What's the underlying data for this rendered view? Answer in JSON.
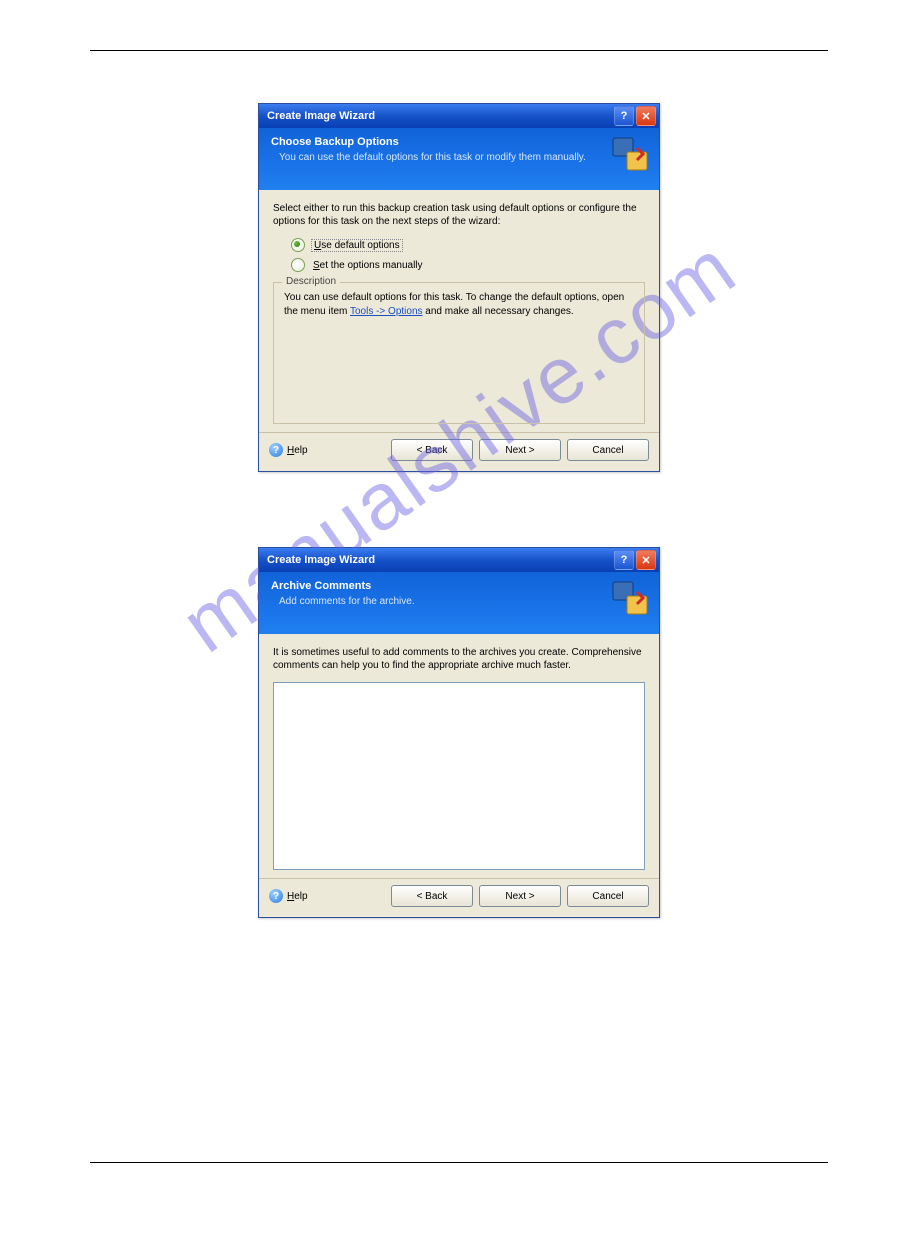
{
  "watermark": "manualshive.com",
  "dialog1": {
    "title": "Create Image Wizard",
    "header_title": "Choose Backup Options",
    "header_sub": "You can use the default options for this task or modify them manually.",
    "instruction": "Select either to run this backup creation task using default options or configure the options for this task on the next steps of the wizard:",
    "radio1_prefix": "U",
    "radio1_text": "se default options",
    "radio2_prefix": "S",
    "radio2_text": "et the options manually",
    "desc_legend": "Description",
    "desc_text_a": "You can use default options for this task. To change the default options, open the menu item ",
    "desc_link": "Tools -> Options",
    "desc_text_b": " and make all necessary changes.",
    "help_prefix": "H",
    "help_text": "elp",
    "btn_back": "< Back",
    "btn_next": "Next >",
    "btn_cancel": "Cancel"
  },
  "dialog2": {
    "title": "Create Image Wizard",
    "header_title": "Archive Comments",
    "header_sub": "Add comments for the archive.",
    "instruction": "It is sometimes useful to add comments to the archives you create. Comprehensive comments can help you to find the appropriate archive much faster.",
    "help_prefix": "H",
    "help_text": "elp",
    "btn_back": "< Back",
    "btn_next": "Next >",
    "btn_cancel": "Cancel"
  }
}
